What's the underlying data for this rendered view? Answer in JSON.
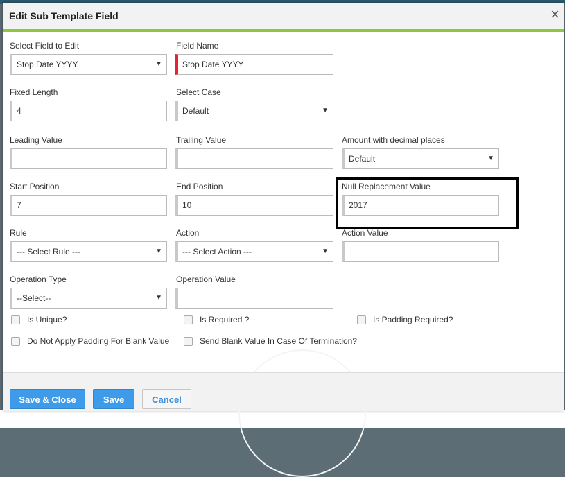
{
  "dialog": {
    "title": "Edit Sub Template Field",
    "close_icon": "×"
  },
  "fields": {
    "select_field_to_edit": {
      "label": "Select Field to Edit",
      "value": "Stop Date YYYY"
    },
    "field_name": {
      "label": "Field Name",
      "value": "Stop Date YYYY"
    },
    "fixed_length": {
      "label": "Fixed Length",
      "value": "4"
    },
    "select_case": {
      "label": "Select Case",
      "value": "Default"
    },
    "leading_value": {
      "label": "Leading Value",
      "value": ""
    },
    "trailing_value": {
      "label": "Trailing Value",
      "value": ""
    },
    "amount_decimal": {
      "label": "Amount with decimal places",
      "value": "Default"
    },
    "start_position": {
      "label": "Start Position",
      "value": "7"
    },
    "end_position": {
      "label": "End Position",
      "value": "10"
    },
    "null_replacement": {
      "label": "Null Replacement Value",
      "value": "2017"
    },
    "rule": {
      "label": "Rule",
      "value": "--- Select Rule ---"
    },
    "action": {
      "label": "Action",
      "value": "--- Select Action ---"
    },
    "action_value": {
      "label": "Action Value",
      "value": ""
    },
    "operation_type": {
      "label": "Operation Type",
      "value": "--Select--"
    },
    "operation_value": {
      "label": "Operation Value",
      "value": ""
    }
  },
  "checkboxes": {
    "is_unique": "Is Unique?",
    "is_required": "Is Required ?",
    "is_padding_required": "Is Padding Required?",
    "no_padding_blank": "Do Not Apply Padding For Blank Value",
    "send_blank_termination": "Send Blank Value In Case Of Termination?"
  },
  "buttons": {
    "save_close": "Save & Close",
    "save": "Save",
    "cancel": "Cancel"
  },
  "select_arrow": "▼",
  "colors": {
    "accent_green": "#8dc63f",
    "primary_blue": "#3d9be9",
    "required_red": "#e8232f"
  },
  "icons": {
    "close": "close-icon",
    "dropdown": "chevron-down-icon",
    "checkbox": "checkbox-icon"
  }
}
